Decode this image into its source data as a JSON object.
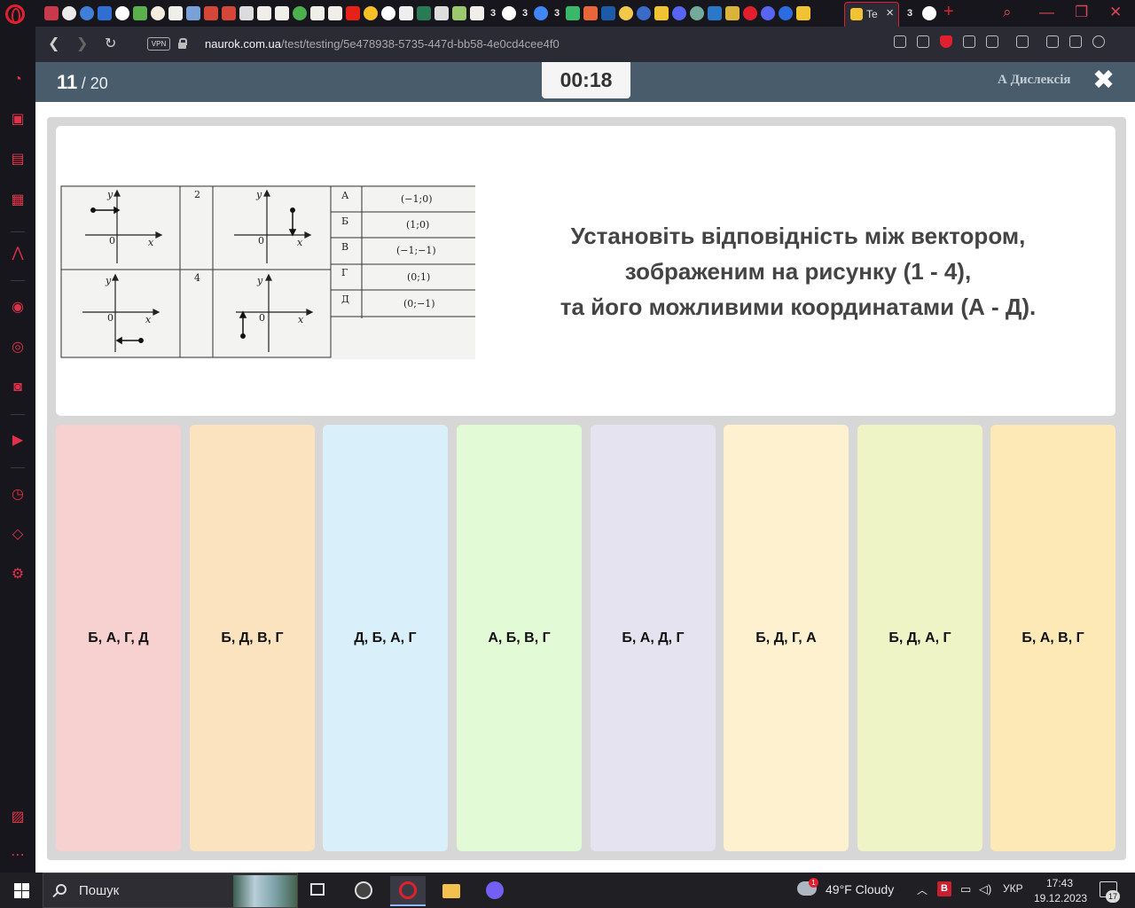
{
  "browser": {
    "active_tab_label": "Te",
    "tab_count_badges": [
      "3",
      "3",
      "3",
      "3"
    ],
    "after_tab_badge": "3",
    "vpn_label": "VPN",
    "url_domain": "naurok.com.ua",
    "url_path": "/test/testing/5e478938-5735-447d-bb58-4e0cd4cee4f0"
  },
  "test": {
    "current_question": "11",
    "total_questions": "/ 20",
    "timer": "00:18",
    "dyslexia_label": "А Дислексія",
    "question_lines": [
      "Установіть відповідність між вектором,",
      "зображеним на рисунку (1 - 4),",
      "та його можливими координатами (А - Д)."
    ],
    "figure": {
      "cell_number_2": "2",
      "cell_number_4": "4",
      "axis_y": "y",
      "axis_x": "x",
      "origin": "0",
      "rows": [
        {
          "letter": "А",
          "coord": "(−1;0)"
        },
        {
          "letter": "Б",
          "coord": "(1;0)"
        },
        {
          "letter": "В",
          "coord": "(−1;−1)"
        },
        {
          "letter": "Г",
          "coord": "(0;1)"
        },
        {
          "letter": "Д",
          "coord": "(0;−1)"
        }
      ]
    },
    "options": [
      {
        "label": "Б, А, Г, Д",
        "color": "#f7d0d0"
      },
      {
        "label": "Б, Д, В, Г",
        "color": "#fbe3c0"
      },
      {
        "label": "Д, Б, А, Г",
        "color": "#d9effa"
      },
      {
        "label": "А, Б, В, Г",
        "color": "#e2fbd6"
      },
      {
        "label": "Б, А, Д, Г",
        "color": "#e5e3f0"
      },
      {
        "label": "Б, Д, Г, А",
        "color": "#fdf1cf"
      },
      {
        "label": "Б, Д, А, Г",
        "color": "#eef4c6"
      },
      {
        "label": "Б, А, В, Г",
        "color": "#fde9b6"
      }
    ]
  },
  "taskbar": {
    "search_label": "Пошук",
    "weather_badge": "1",
    "weather": "49°F  Cloudy",
    "keyboard_badge": "B",
    "language": "УКР",
    "time": "17:43",
    "date": "19.12.2023",
    "notification_count": "17"
  },
  "colors": {
    "accent": "#e0202f",
    "topbar": "#485c6b",
    "stage": "#d7d7d7"
  }
}
